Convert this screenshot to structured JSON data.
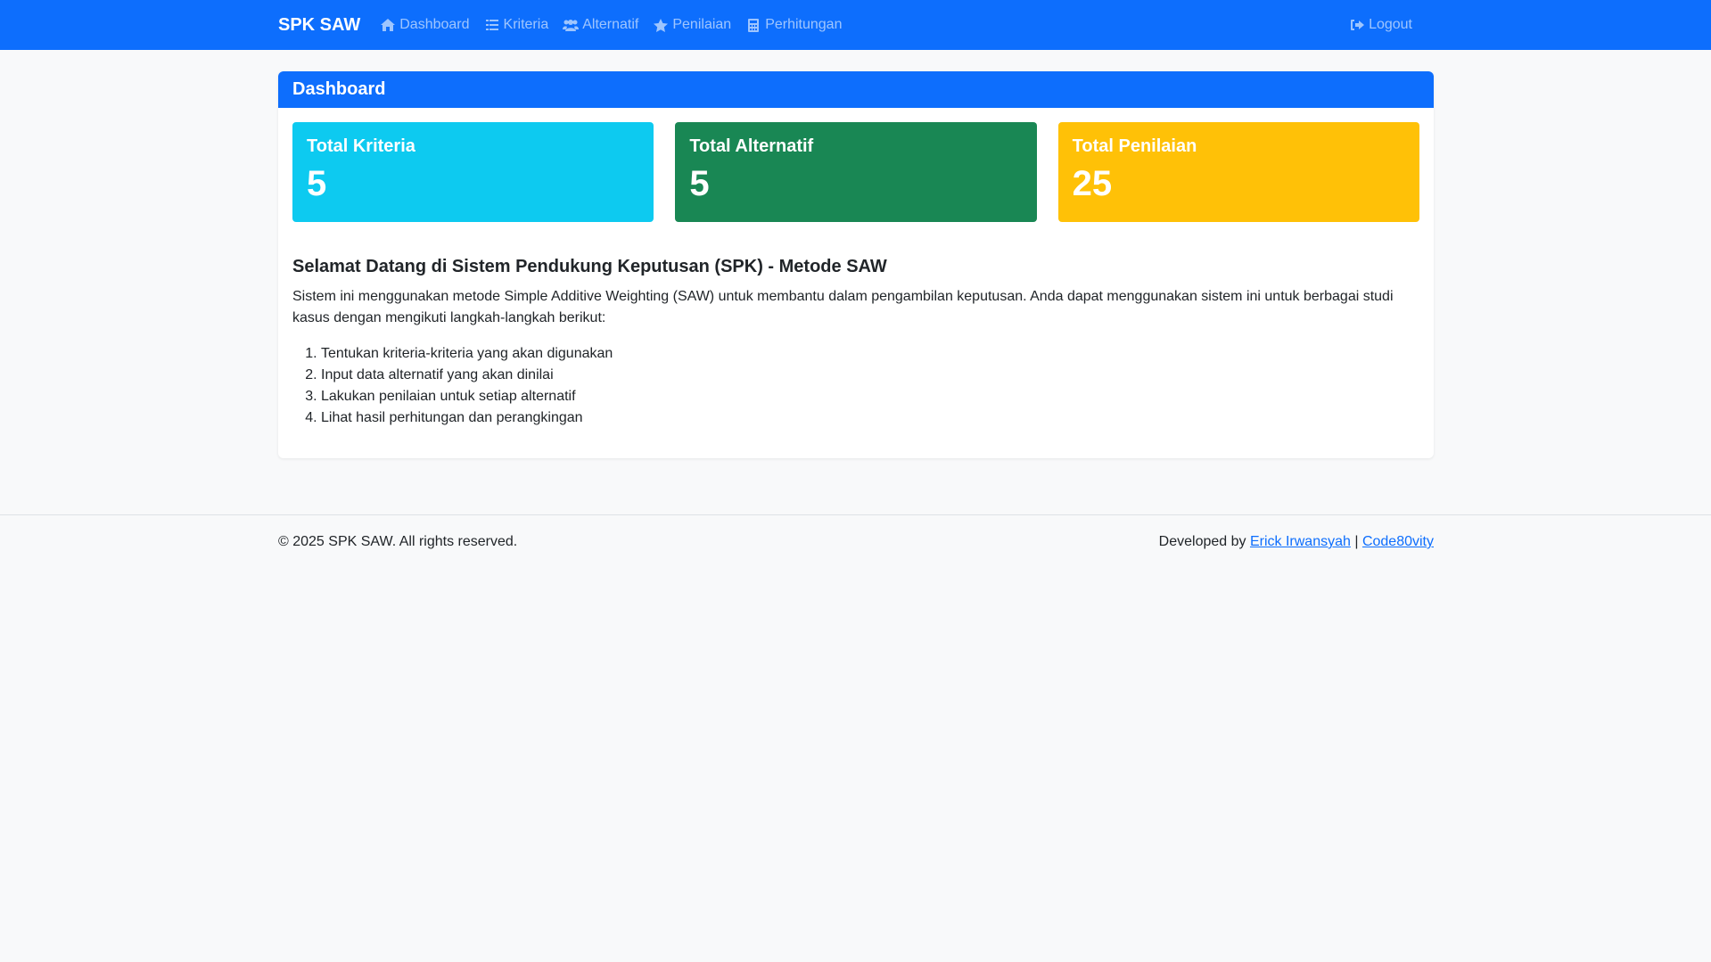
{
  "navbar": {
    "brand": "SPK SAW",
    "links": [
      {
        "label": "Dashboard",
        "icon": "home-icon"
      },
      {
        "label": "Kriteria",
        "icon": "list-icon"
      },
      {
        "label": "Alternatif",
        "icon": "users-icon"
      },
      {
        "label": "Penilaian",
        "icon": "star-icon"
      },
      {
        "label": "Perhitungan",
        "icon": "calculator-icon"
      }
    ],
    "logout": {
      "label": "Logout",
      "icon": "logout-icon"
    }
  },
  "card": {
    "title": "Dashboard",
    "stats": [
      {
        "label": "Total Kriteria",
        "value": "5",
        "color": "#0dcaf0"
      },
      {
        "label": "Total Alternatif",
        "value": "5",
        "color": "#198754"
      },
      {
        "label": "Total Penilaian",
        "value": "25",
        "color": "#ffc107"
      }
    ],
    "welcome": {
      "heading": "Selamat Datang di Sistem Pendukung Keputusan (SPK) - Metode SAW",
      "paragraph": "Sistem ini menggunakan metode Simple Additive Weighting (SAW) untuk membantu dalam pengambilan keputusan. Anda dapat menggunakan sistem ini untuk berbagai studi kasus dengan mengikuti langkah-langkah berikut:",
      "steps": [
        "Tentukan kriteria-kriteria yang akan digunakan",
        "Input data alternatif yang akan dinilai",
        "Lakukan penilaian untuk setiap alternatif",
        "Lihat hasil perhitungan dan perangkingan"
      ]
    }
  },
  "footer": {
    "copyright": "© 2025 SPK SAW. All rights reserved.",
    "developed_by": "Developed by",
    "author_link": "Erick Irwansyah",
    "separator": "|",
    "org_link": "Code80vity"
  },
  "colors": {
    "primary": "#0d6efd",
    "background": "#f8f9fa"
  }
}
